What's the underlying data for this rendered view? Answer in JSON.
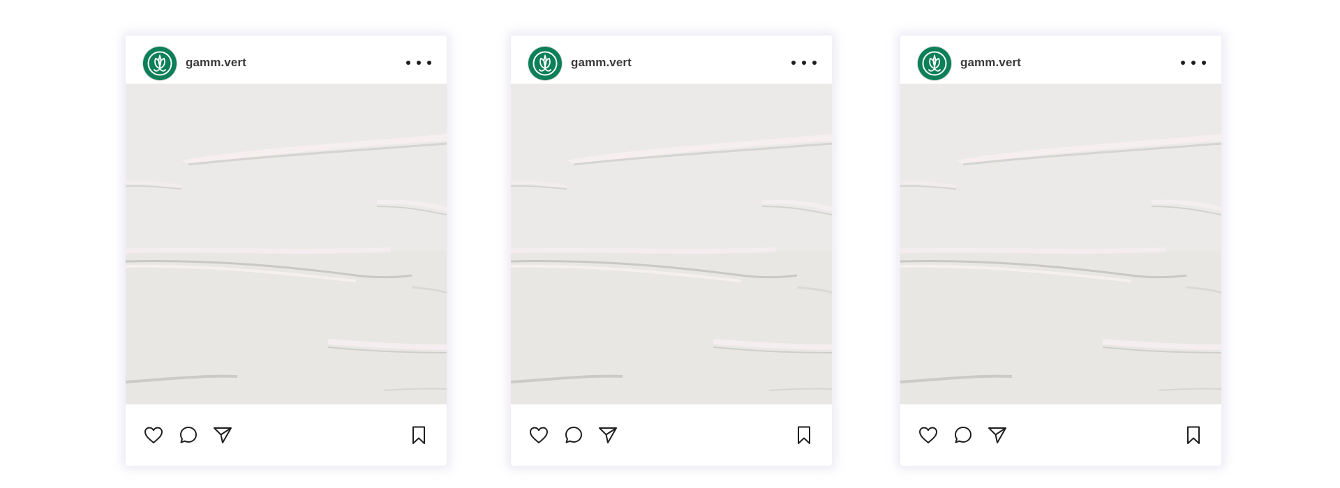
{
  "posts": [
    {
      "username": "gamm.vert",
      "avatar_icon": "leaf-sprout-icon",
      "brand_color": "#0b7f57",
      "actions": [
        "heart-icon",
        "comment-icon",
        "send-icon",
        "bookmark-icon"
      ]
    },
    {
      "username": "gamm.vert",
      "avatar_icon": "leaf-sprout-icon",
      "brand_color": "#0b7f57",
      "actions": [
        "heart-icon",
        "comment-icon",
        "send-icon",
        "bookmark-icon"
      ]
    },
    {
      "username": "gamm.vert",
      "avatar_icon": "leaf-sprout-icon",
      "brand_color": "#0b7f57",
      "actions": [
        "heart-icon",
        "comment-icon",
        "send-icon",
        "bookmark-icon"
      ]
    }
  ],
  "colors": {
    "media_background": "#ebeae8",
    "icon_stroke": "#1e1e1e",
    "card_shadow": "#e4e0ee"
  }
}
